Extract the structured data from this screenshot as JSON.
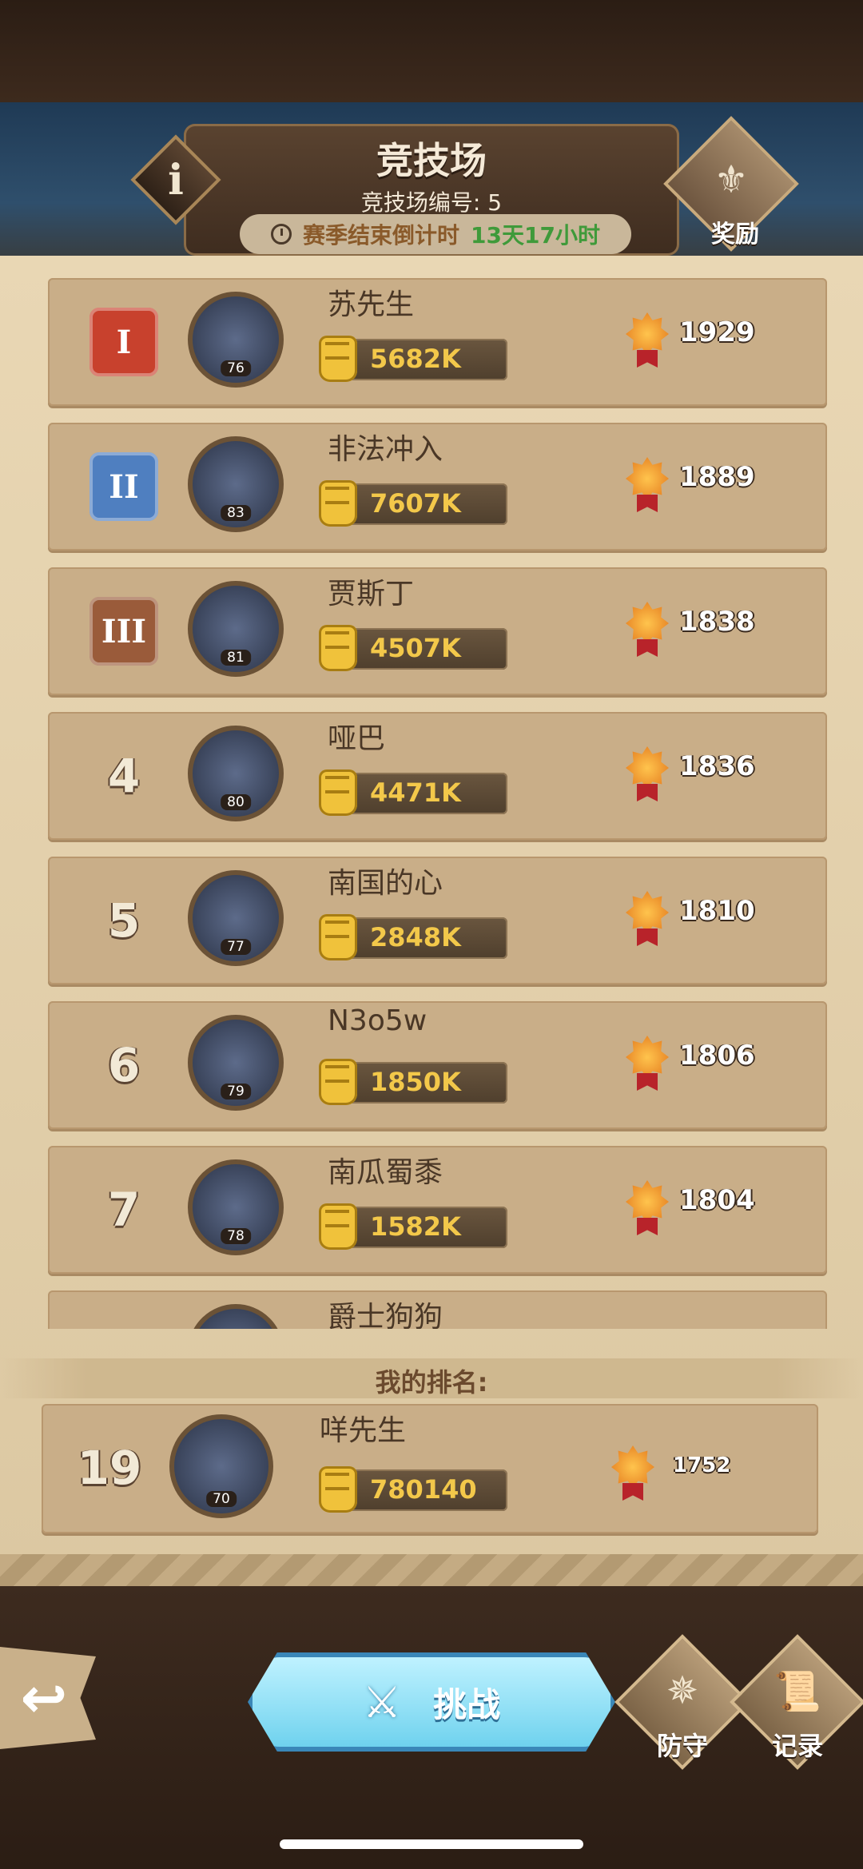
{
  "header": {
    "title": "竞技场",
    "subtitle": "竞技场编号: 5",
    "season_label": "赛季结束倒计时",
    "season_value": "13天17小时",
    "info_glyph": "i",
    "reward_label": "奖励"
  },
  "rows": [
    {
      "rank": "I",
      "name": "苏先生",
      "level": "76",
      "power": "5682K",
      "score": "1929"
    },
    {
      "rank": "II",
      "name": "非法冲入",
      "level": "83",
      "power": "7607K",
      "score": "1889"
    },
    {
      "rank": "III",
      "name": "贾斯丁",
      "level": "81",
      "power": "4507K",
      "score": "1838"
    },
    {
      "rank": "4",
      "name": "哑巴",
      "level": "80",
      "power": "4471K",
      "score": "1836"
    },
    {
      "rank": "5",
      "name": "南国的心",
      "level": "77",
      "power": "2848K",
      "score": "1810"
    },
    {
      "rank": "6",
      "name": "N3o5w",
      "level": "79",
      "power": "1850K",
      "score": "1806"
    },
    {
      "rank": "7",
      "name": "南瓜蜀黍",
      "level": "78",
      "power": "1582K",
      "score": "1804"
    },
    {
      "rank": "",
      "name": "爵士狗狗",
      "level": "",
      "power": "",
      "score": ""
    }
  ],
  "my_rank": {
    "label": "我的排名:",
    "rank": "19",
    "name": "咩先生",
    "level": "70",
    "power": "780140",
    "score": "1752"
  },
  "bottom": {
    "back_glyph": "↩",
    "challenge_label": "挑战",
    "defense_label": "防守",
    "record_label": "记录"
  },
  "colors": {
    "gold_crest": "#c8412d",
    "silver_crest": "#4f7fc0",
    "bronze_crest": "#9a5b3a",
    "power_text": "#f3c84a",
    "countdown": "#3f9a3a"
  }
}
